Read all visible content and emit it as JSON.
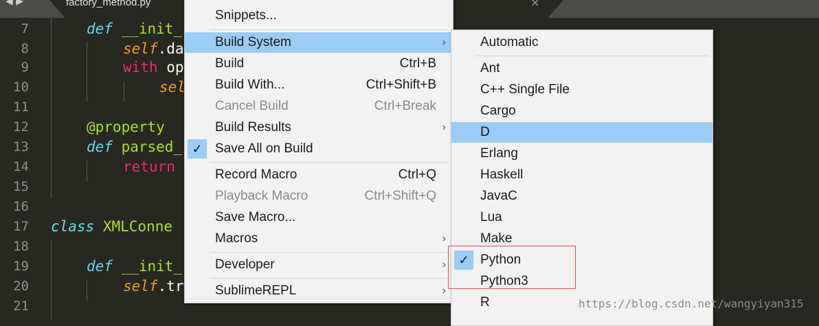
{
  "tab": {
    "filename": "factory_method.py",
    "close": "×",
    "nav": "◀ ▶"
  },
  "gutter": {
    "lines": [
      "7",
      "8",
      "9",
      "10",
      "11",
      "12",
      "13",
      "14",
      "15",
      "16",
      "17",
      "18",
      "19",
      "20",
      "21"
    ]
  },
  "code": {
    "l7_def": "def",
    "l7_rest": " __init_",
    "l8_self": "self",
    "l8_rest": ".da",
    "l9_kw": "with",
    "l9_rest": " op",
    "l10_self": "sel",
    "l12_deco": "@property",
    "l13_def": "def",
    "l13_rest": " parsed_",
    "l14_kw": "return",
    "l17_class": "class",
    "l17_rest": " XMLConne",
    "l19_def": "def",
    "l19_rest": " __init_",
    "l20_self": "self",
    "l20_rest": ".tr"
  },
  "menu": {
    "items": [
      {
        "label": "Snippets..."
      },
      {
        "label": "Build System"
      },
      {
        "label": "Build",
        "shortcut": "Ctrl+B"
      },
      {
        "label": "Build With...",
        "shortcut": "Ctrl+Shift+B"
      },
      {
        "label": "Cancel Build",
        "shortcut": "Ctrl+Break"
      },
      {
        "label": "Build Results"
      },
      {
        "label": "Save All on Build"
      },
      {
        "label": "Record Macro",
        "shortcut": "Ctrl+Q"
      },
      {
        "label": "Playback Macro",
        "shortcut": "Ctrl+Shift+Q"
      },
      {
        "label": "Save Macro..."
      },
      {
        "label": "Macros"
      },
      {
        "label": "Developer"
      },
      {
        "label": "SublimeREPL"
      }
    ]
  },
  "submenu": {
    "items": [
      {
        "label": "Automatic"
      },
      {
        "label": "Ant"
      },
      {
        "label": "C++ Single File"
      },
      {
        "label": "Cargo"
      },
      {
        "label": "D"
      },
      {
        "label": "Erlang"
      },
      {
        "label": "Haskell"
      },
      {
        "label": "JavaC"
      },
      {
        "label": "Lua"
      },
      {
        "label": "Make"
      },
      {
        "label": "Python"
      },
      {
        "label": "Python3"
      },
      {
        "label": "R"
      }
    ]
  },
  "glyphs": {
    "check": "✓",
    "arrow": "›"
  },
  "watermark": "https://blog.csdn.net/wangyiyan315",
  "colors": {
    "highlight": "#99ccf6",
    "redbox": "#e05050",
    "editor_bg": "#272822"
  }
}
